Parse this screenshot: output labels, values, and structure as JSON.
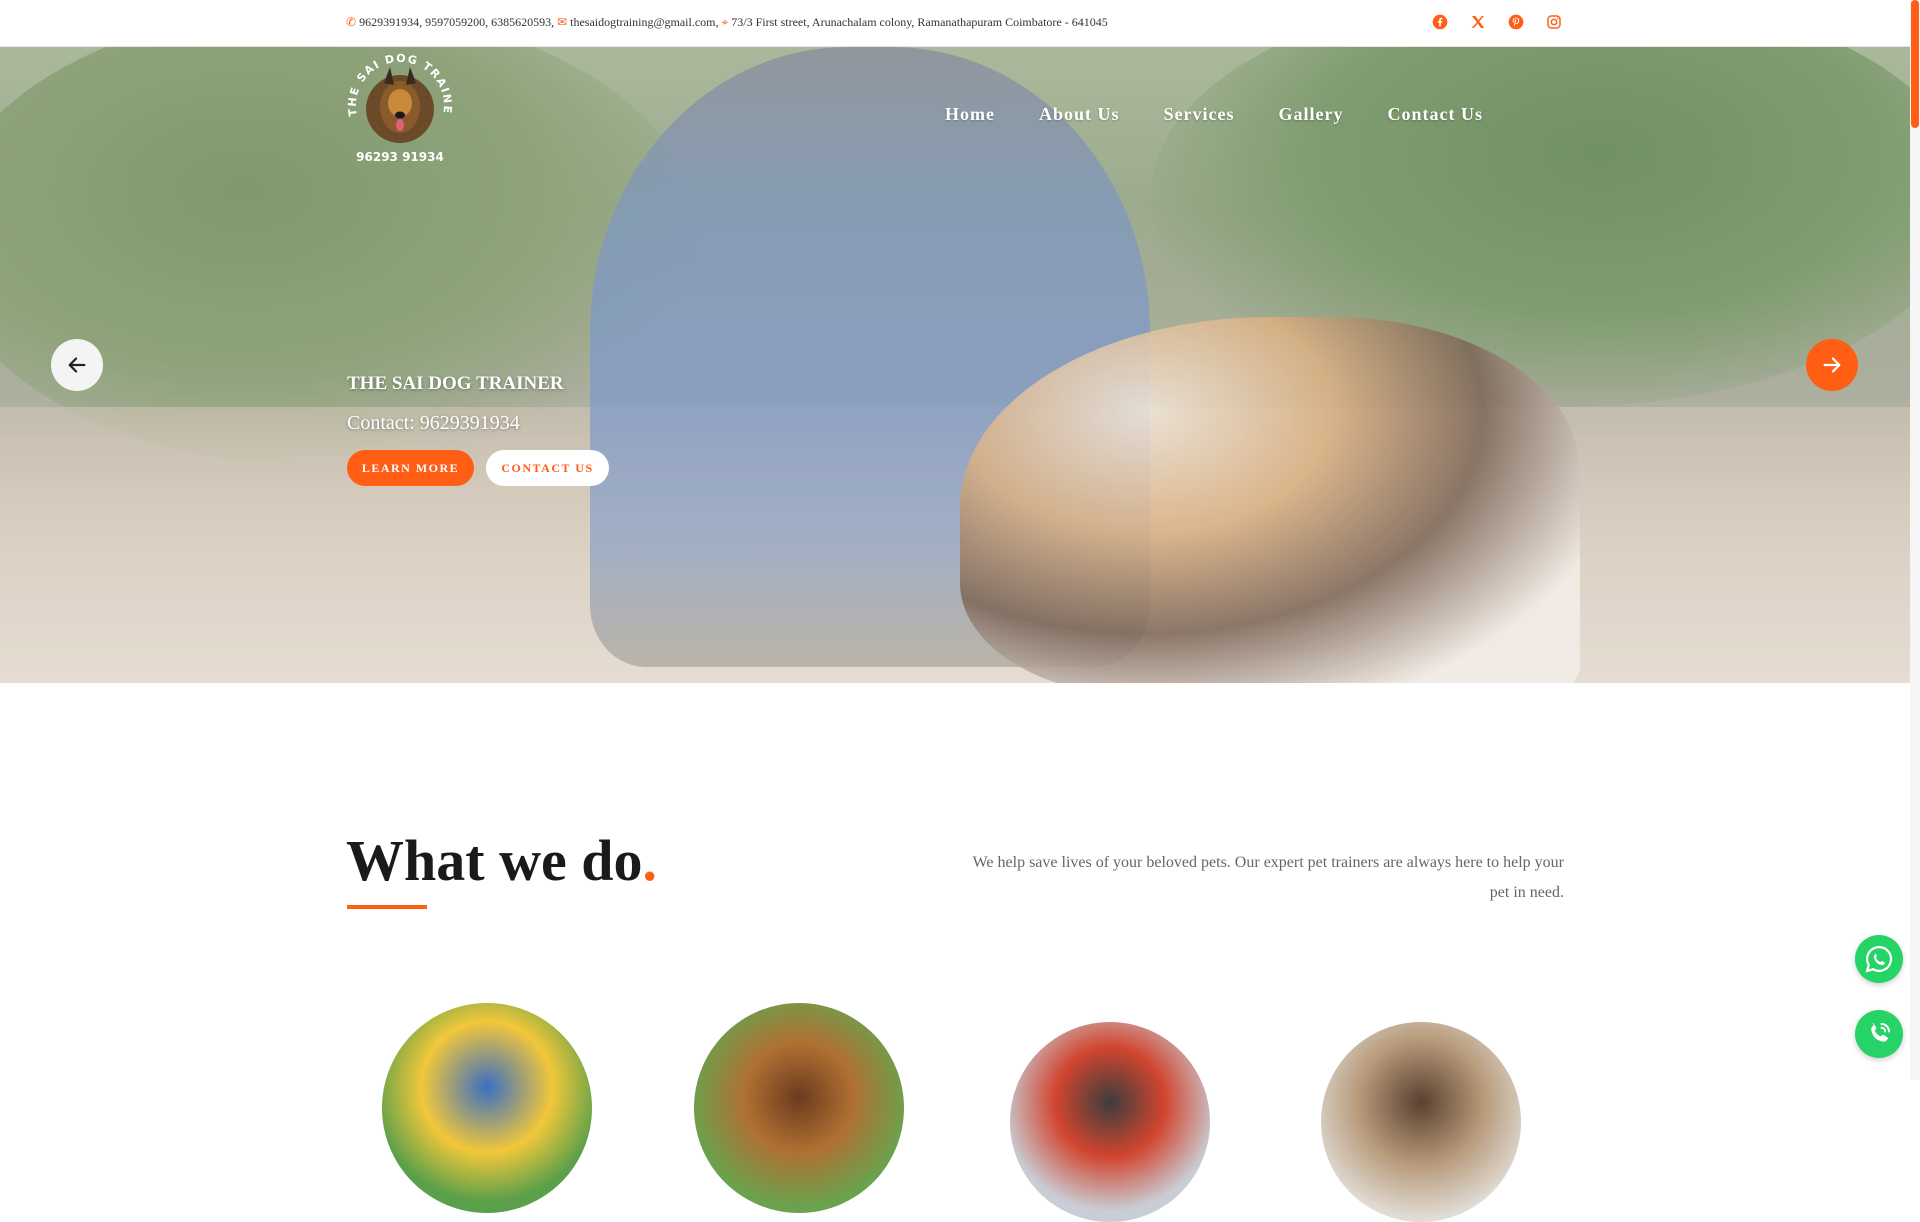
{
  "topbar": {
    "phones": "9629391934, 9597059200, 6385620593,",
    "email": "thesaidogtraining@gmail.com,",
    "address": "73/3 First street, Arunachalam colony, Ramanathapuram Coimbatore - 641045",
    "socials": [
      "facebook-icon",
      "x-twitter-icon",
      "pinterest-icon",
      "instagram-icon"
    ]
  },
  "logo": {
    "ring_text": "THE SAI DOG TRAINER",
    "phone": "96293 91934"
  },
  "nav": {
    "items": [
      "Home",
      "About Us",
      "Services",
      "Gallery",
      "Contact Us"
    ]
  },
  "hero": {
    "title": "THE SAI DOG TRAINER",
    "subtitle": "Contact: 9629391934",
    "learn_more": "LEARN MORE",
    "contact_us": "CONTACT US"
  },
  "what_we_do": {
    "title": "What we do",
    "title_dot": ".",
    "description": "We help save lives of your beloved pets. Our expert pet trainers are always here to help your pet in need."
  },
  "colors": {
    "accent": "#ff5e14",
    "whatsapp": "#25d366",
    "heading": "#1a1a1a",
    "body_text": "#666666"
  }
}
